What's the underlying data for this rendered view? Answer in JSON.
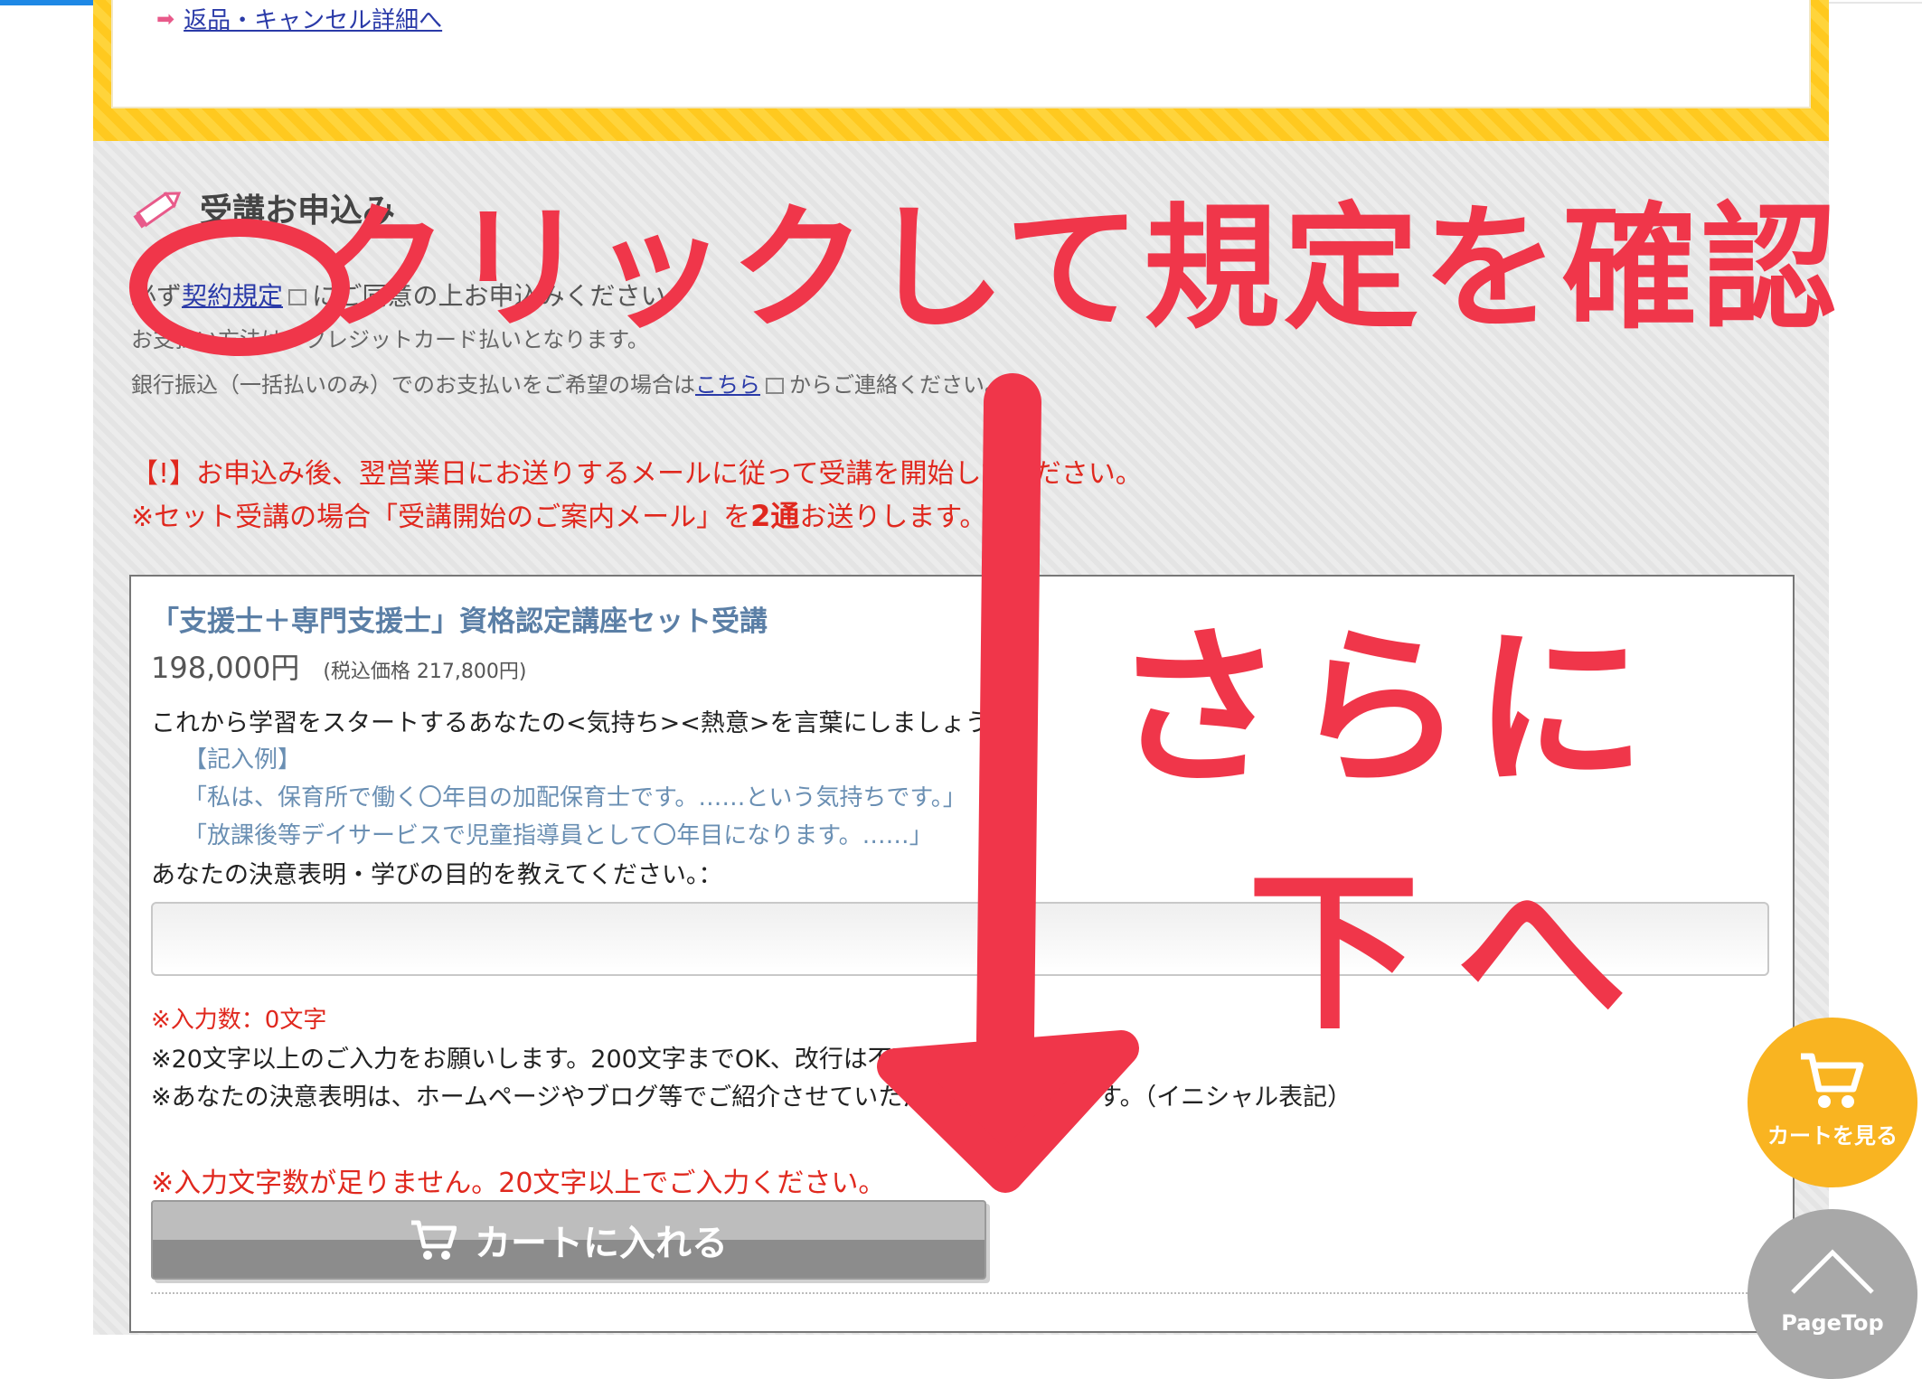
{
  "top_notice": {
    "return_link": "返品・キャンセル詳細へ"
  },
  "apply": {
    "title": "受講お申込み",
    "agree_prefix": "必ず",
    "agree_link": "契約規定",
    "agree_suffix": "にご同意の上お申込みください。",
    "payment_note": "お支払い方法は、クレジットカード払いとなります。",
    "bank_prefix": "銀行振込（一括払いのみ）でのお支払いをご希望の場合は",
    "bank_link": "こちら",
    "bank_suffix": "からご連絡ください。",
    "notice_1": "【!】お申込み後、翌営業日にお送りするメールに従って受講を開始してください。",
    "notice_2_prefix": "※セット受講の場合「受講開始のご案内メール」を",
    "notice_2_bold": "2通",
    "notice_2_suffix": "お送りします。"
  },
  "course": {
    "title": "「支援士＋専門支援士」資格認定講座セット受講",
    "price": "198,000円",
    "tax_price": "(税込価格 217,800円)",
    "prompt": "これから学習をスタートするあなたの<気持ち><熱意>を言葉にしましょう。",
    "example_label": "【記入例】",
    "example_1": "「私は、保育所で働く〇年目の加配保育士です。……という気持ちです。」",
    "example_2": "「放課後等デイサービスで児童指導員として〇年目になります。……」",
    "ask": "あなたの決意表明・学びの目的を教えてください。：",
    "input_value": "",
    "char_count": "※入力数：0文字",
    "note_1": "※20文字以上のご入力をお願いします。200文字までOK、改行は不可です。",
    "note_2": "※あなたの決意表明は、ホームページやブログ等でご紹介させていただく場合があります。（イニシャル表記）",
    "error": "※入力文字数が足りません。20文字以上でご入力ください。",
    "cart_button": "カートに入れる"
  },
  "floating": {
    "view_cart": "カートを見る",
    "page_top": "PageTop"
  },
  "annotations": {
    "line_1": "クリックして規定を確認",
    "line_2": "さらに",
    "line_3": "下へ"
  },
  "colors": {
    "accent_red": "#e0281e",
    "annotation_red": "#f0364a",
    "link_blue": "#2a3aa8",
    "frame_yellow": "#ffd43b",
    "cart_fab": "#f9b421"
  },
  "icons": [
    "arrow-right-icon",
    "pencil-icon",
    "external-link-icon",
    "cart-icon",
    "chevron-up-icon"
  ]
}
